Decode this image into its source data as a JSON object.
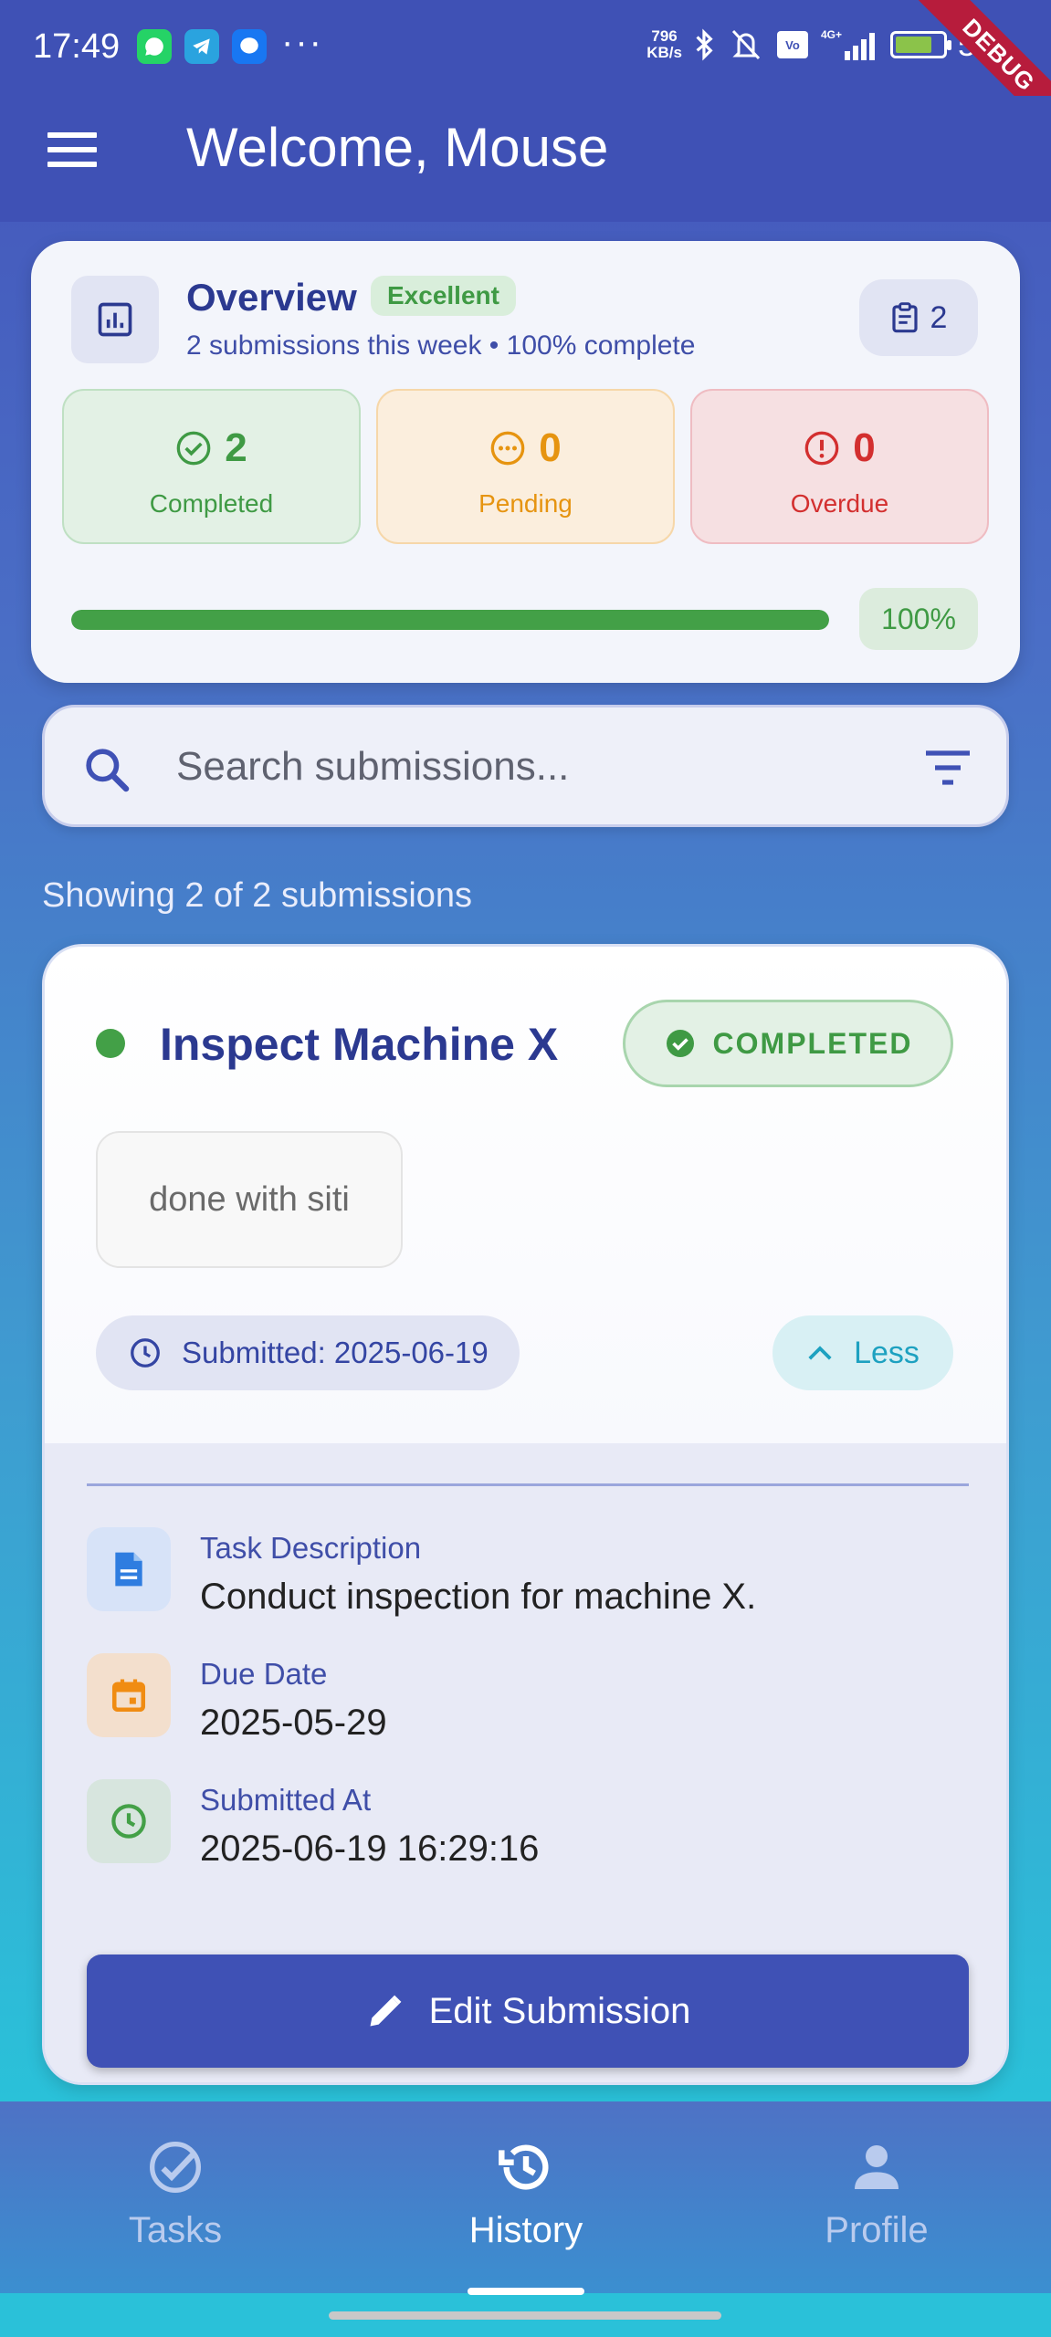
{
  "status_bar": {
    "time": "17:49",
    "net_speed_value": "796",
    "net_speed_unit": "KB/s",
    "battery": "57",
    "debug_label": "DEBUG"
  },
  "app_bar": {
    "title": "Welcome, Mouse"
  },
  "overview": {
    "title": "Overview",
    "badge": "Excellent",
    "subtitle": "2 submissions this week • 100% complete",
    "count": "2",
    "stats": [
      {
        "value": "2",
        "label": "Completed"
      },
      {
        "value": "0",
        "label": "Pending"
      },
      {
        "value": "0",
        "label": "Overdue"
      }
    ],
    "progress_fraction": 1.0,
    "progress_label": "100%"
  },
  "search": {
    "placeholder": "Search submissions..."
  },
  "showing_text": "Showing 2 of 2 submissions",
  "submission": {
    "title": "Inspect Machine X",
    "status": "COMPLETED",
    "note": "done with siti",
    "submitted": "Submitted: 2025-06-19",
    "toggle_label": "Less",
    "details": [
      {
        "label": "Task Description",
        "value": "Conduct inspection for machine X."
      },
      {
        "label": "Due Date",
        "value": "2025-05-29"
      },
      {
        "label": "Submitted At",
        "value": "2025-06-19 16:29:16"
      }
    ],
    "edit_label": "Edit Submission"
  },
  "nav": {
    "items": [
      {
        "label": "Tasks",
        "icon": "check-circle-icon"
      },
      {
        "label": "History",
        "icon": "history-icon"
      },
      {
        "label": "Profile",
        "icon": "person-icon"
      }
    ],
    "active": "History"
  },
  "colors": {
    "primary": "#3f51b5",
    "success": "#43a047",
    "warning": "#e69410",
    "danger": "#d32f2f",
    "accent": "#1da1c0"
  }
}
